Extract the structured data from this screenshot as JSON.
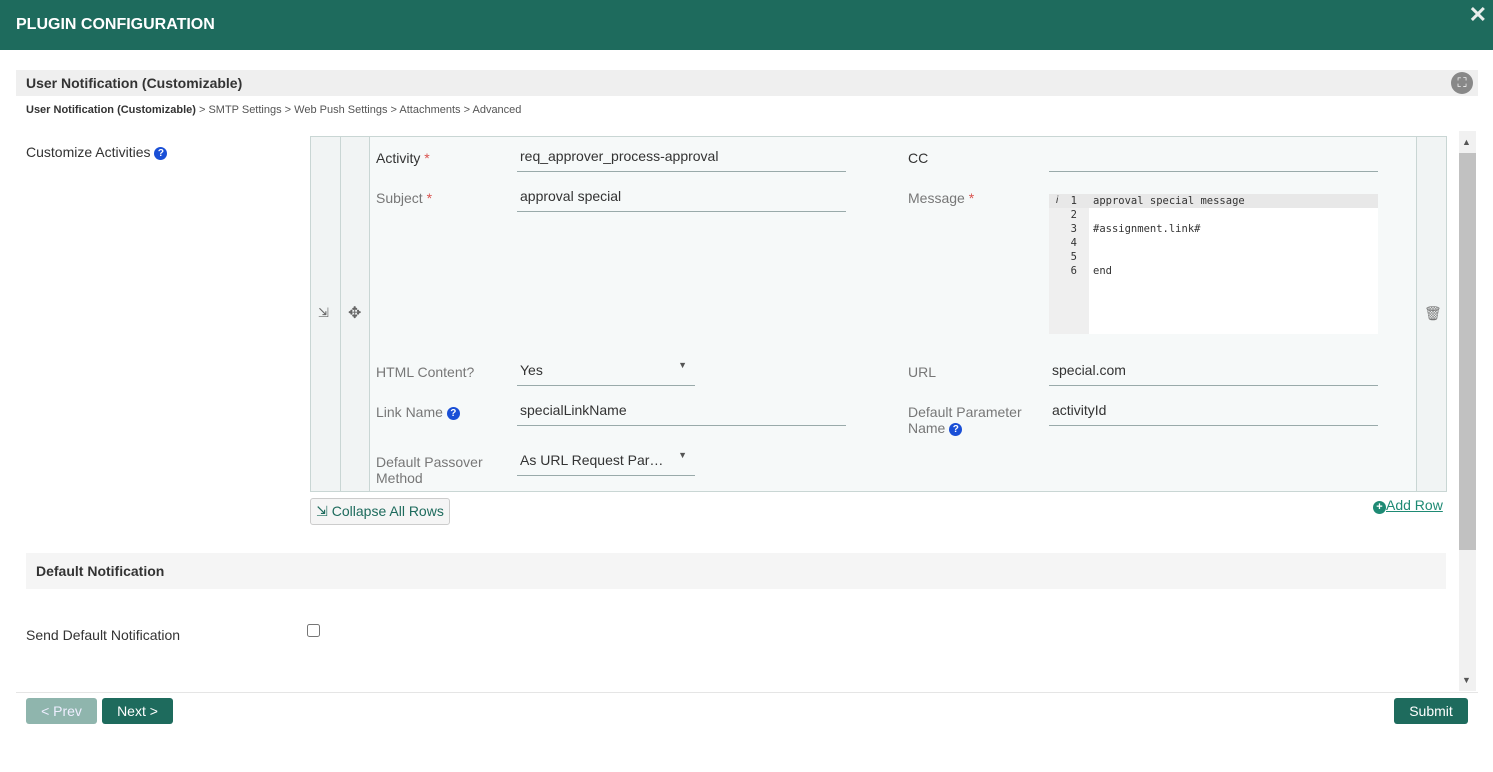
{
  "window": {
    "title": "PLUGIN CONFIGURATION",
    "close_icon": "close-icon"
  },
  "section": {
    "title": "User Notification (Customizable)",
    "fullscreen_icon": "fullscreen-icon"
  },
  "breadcrumb": {
    "current": "User Notification (Customizable)",
    "rest": " > SMTP Settings > Web Push Settings > Attachments > Advanced"
  },
  "customize": {
    "label": "Customize Activities",
    "row": {
      "activity_label": "Activity",
      "activity_value": "req_approver_process-approval",
      "cc_label": "CC",
      "cc_value": "",
      "subject_label": "Subject",
      "subject_value": "approval special",
      "message_label": "Message",
      "message_lines": [
        {
          "n": "1",
          "text": "approval special message"
        },
        {
          "n": "2",
          "text": ""
        },
        {
          "n": "3",
          "text": "#assignment.link#"
        },
        {
          "n": "4",
          "text": ""
        },
        {
          "n": "5",
          "text": ""
        },
        {
          "n": "6",
          "text": "end"
        }
      ],
      "html_content_label": "HTML Content?",
      "html_content_value": "Yes",
      "url_label": "URL",
      "url_value": "special.com",
      "link_name_label": "Link Name",
      "link_name_value": "specialLinkName",
      "default_param_label_1": "Default Parameter",
      "default_param_label_2": "Name",
      "default_param_value": "activityId",
      "passover_label_1": "Default Passover",
      "passover_label_2": "Method",
      "passover_value": "As URL Request Par…"
    },
    "required_marker": "*",
    "collapse_label": "Collapse All Rows",
    "add_row_label": "Add Row"
  },
  "default_notification": {
    "title": "Default Notification",
    "send_label": "Send Default Notification",
    "send_checked": false
  },
  "footer": {
    "prev": "< Prev",
    "next": "Next >",
    "submit": "Submit"
  },
  "colors": {
    "brand": "#1e6b5d",
    "required": "#d9534f",
    "help": "#1a4fd6"
  }
}
